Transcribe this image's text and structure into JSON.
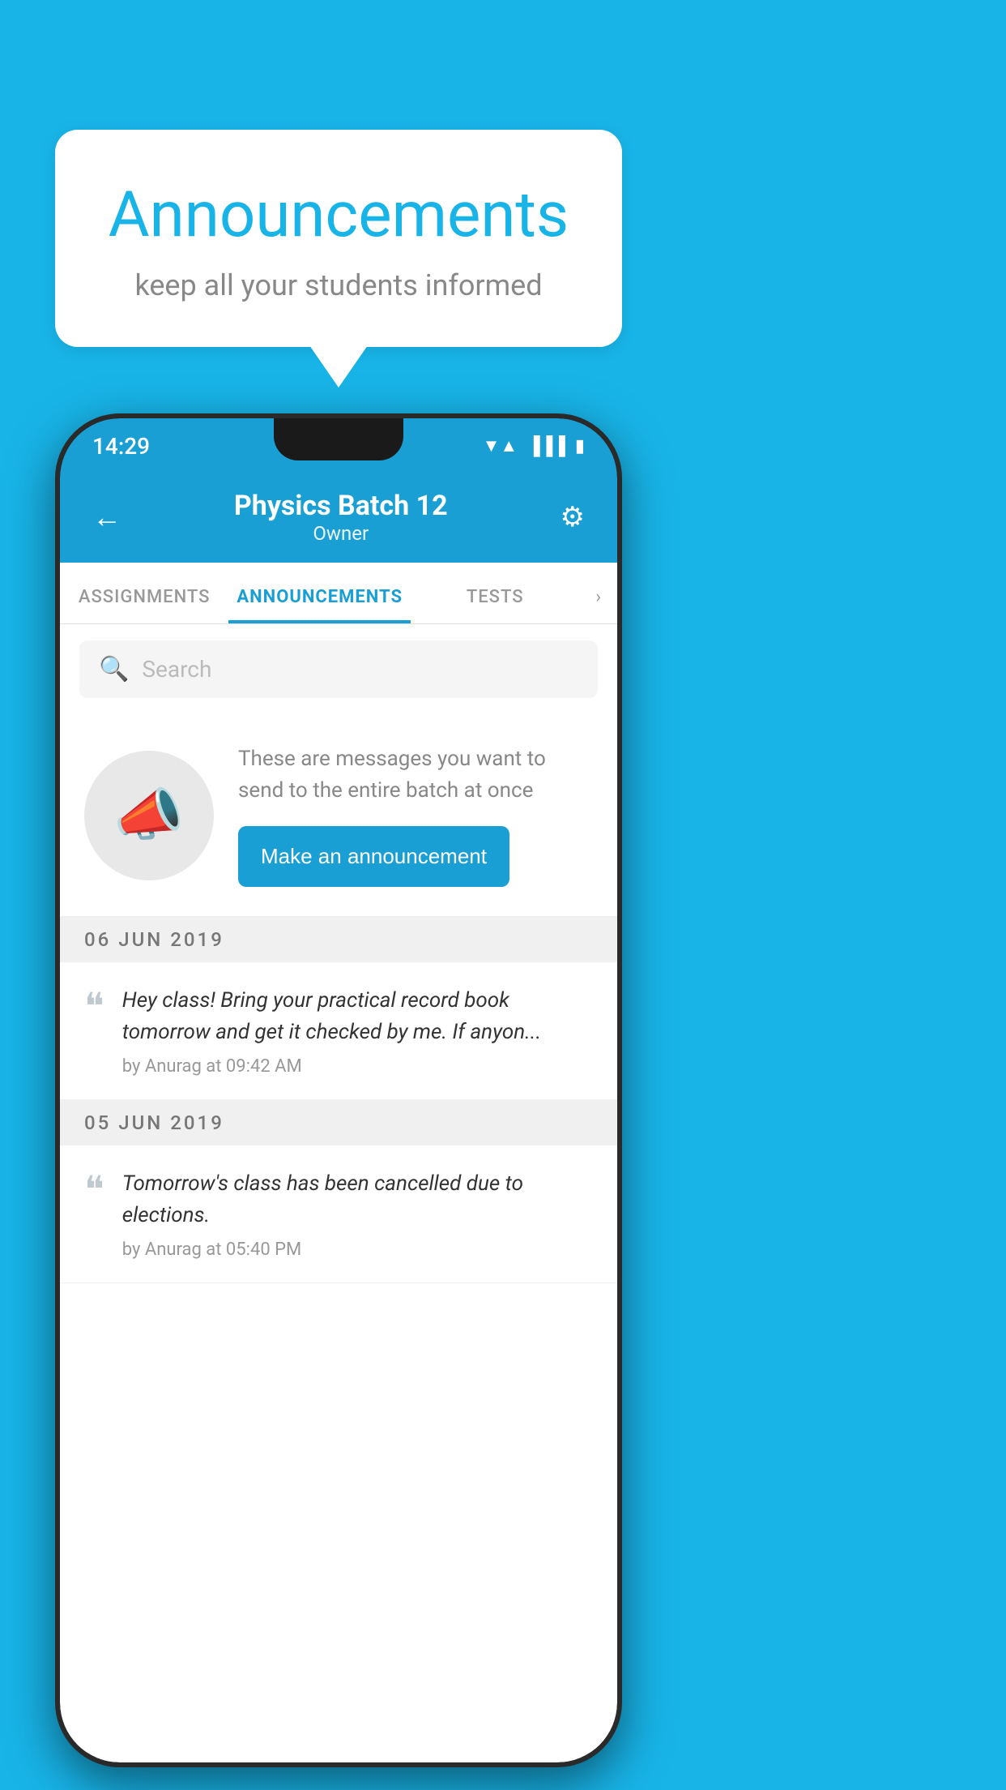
{
  "background_color": "#18B4E8",
  "speech_bubble": {
    "title": "Announcements",
    "subtitle": "keep all your students informed"
  },
  "status_bar": {
    "time": "14:29",
    "icons": [
      "wifi",
      "signal",
      "battery"
    ]
  },
  "header": {
    "title": "Physics Batch 12",
    "subtitle": "Owner",
    "back_label": "←",
    "settings_label": "⚙"
  },
  "tabs": [
    {
      "label": "ASSIGNMENTS",
      "active": false
    },
    {
      "label": "ANNOUNCEMENTS",
      "active": true
    },
    {
      "label": "TESTS",
      "active": false
    }
  ],
  "search": {
    "placeholder": "Search"
  },
  "empty_state": {
    "description": "These are messages you want to send to the entire batch at once",
    "button_label": "Make an announcement"
  },
  "announcements": [
    {
      "date": "06  JUN  2019",
      "text": "Hey class! Bring your practical record book tomorrow and get it checked by me. If anyon...",
      "meta": "by Anurag at 09:42 AM"
    },
    {
      "date": "05  JUN  2019",
      "text": "Tomorrow's class has been cancelled due to elections.",
      "meta": "by Anurag at 05:40 PM"
    }
  ]
}
